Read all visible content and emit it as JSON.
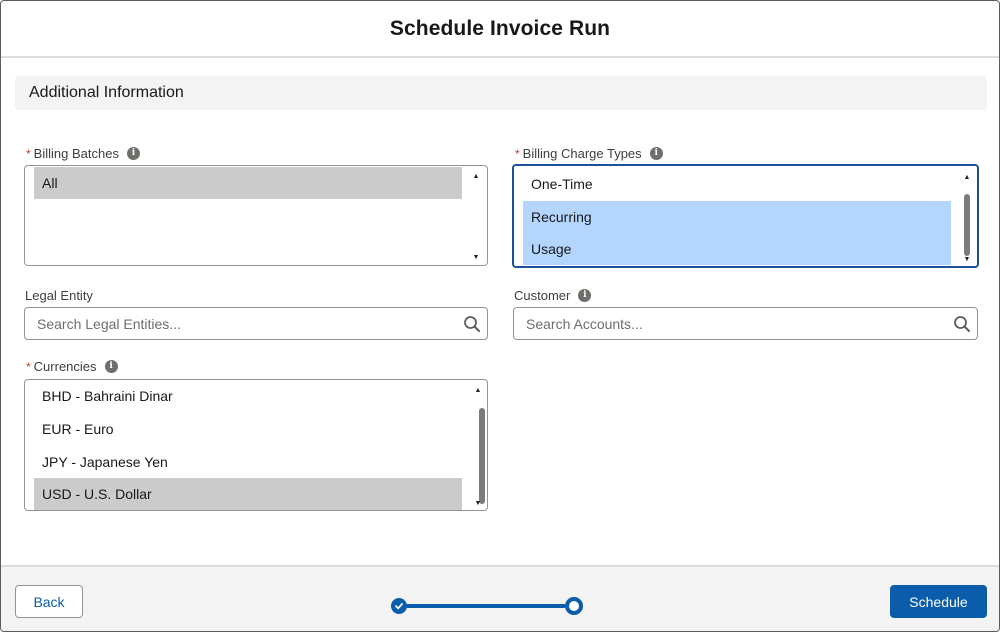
{
  "modal": {
    "title": "Schedule Invoice Run"
  },
  "section": {
    "title": "Additional Information"
  },
  "billing_batches": {
    "label": "Billing Batches",
    "options": [
      "All"
    ]
  },
  "billing_charge_types": {
    "label": "Billing Charge Types",
    "options": [
      "One-Time",
      "Recurring",
      "Usage"
    ]
  },
  "legal_entity": {
    "label": "Legal Entity",
    "placeholder": "Search Legal Entities..."
  },
  "customer": {
    "label": "Customer",
    "placeholder": "Search Accounts..."
  },
  "currencies": {
    "label": "Currencies",
    "options": [
      "BHD - Bahraini Dinar",
      "EUR - Euro",
      "JPY - Japanese Yen",
      "USD - U.S. Dollar"
    ]
  },
  "footer": {
    "back_label": "Back",
    "schedule_label": "Schedule"
  },
  "colors": {
    "brand": "#0b5cab",
    "required": "#c23934",
    "selected_blue": "#b4d5fe",
    "selected_grey": "#cbcbcb"
  },
  "icons": {
    "info": "info-icon",
    "search": "search-icon",
    "check": "check-icon"
  }
}
